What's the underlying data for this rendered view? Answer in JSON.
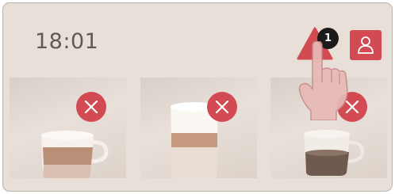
{
  "status_bar": {
    "time": "18:01",
    "warning_count": "1",
    "warning_icon": "warning-triangle-icon",
    "user_icon": "user-icon"
  },
  "drink_tiles": [
    {
      "drink": "cappuccino",
      "delete_icon": "close-icon"
    },
    {
      "drink": "latte-macchiato",
      "delete_icon": "close-icon"
    },
    {
      "drink": "coffee",
      "delete_icon": "close-icon"
    }
  ],
  "colors": {
    "accent_red": "#d24a52",
    "screen_background": "#e8dfd8",
    "text": "#5e5a57",
    "badge": "#1b1b1b"
  }
}
